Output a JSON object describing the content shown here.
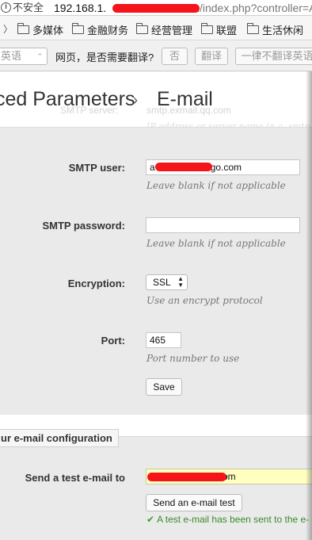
{
  "browser": {
    "security_label": "不安全",
    "info_icon": "info-icon",
    "url_host": "192.168.1.",
    "url_path": "n/index.php?controller=Ac"
  },
  "bookmarks": {
    "items": [
      "多媒体",
      "金融财务",
      "经营管理",
      "联盟",
      "生活休闲"
    ]
  },
  "translate_bar": {
    "language": "英语",
    "question": "网页，是否需要翻译?",
    "no_label": "否",
    "translate_label": "翻译",
    "never_label": "一律不翻译英语"
  },
  "header": {
    "breadcrumb_parent": "ced Parameters",
    "separator": "›",
    "title": "E-mail",
    "ghost_label": "SMTP server:",
    "ghost_value": "smtp.exmail.qq.com",
    "ghost_hint": "IP address or server name (e.g. smtp"
  },
  "form": {
    "smtp_user_label": "SMTP user:",
    "smtp_user_prefix": "a",
    "smtp_user_suffix": "go.com",
    "smtp_user_hint": "Leave blank if not applicable",
    "smtp_password_label": "SMTP password:",
    "smtp_password_value": "",
    "smtp_password_hint": "Leave blank if not applicable",
    "encryption_label": "Encryption:",
    "encryption_value": "SSL",
    "encryption_hint": "Use an encrypt protocol",
    "port_label": "Port:",
    "port_value": "465",
    "port_hint": "Port number to use",
    "save_label": "Save"
  },
  "test": {
    "section_title": "ur e-mail configuration",
    "send_label": "Send a test e-mail to",
    "email_suffix": "om",
    "button_label": "Send an e-mail test",
    "success_message": "A test e-mail has been sent to the e-"
  },
  "colors": {
    "redaction": "#f4141a",
    "success": "#3a8a2a",
    "highlight_field": "#ffffc0"
  }
}
